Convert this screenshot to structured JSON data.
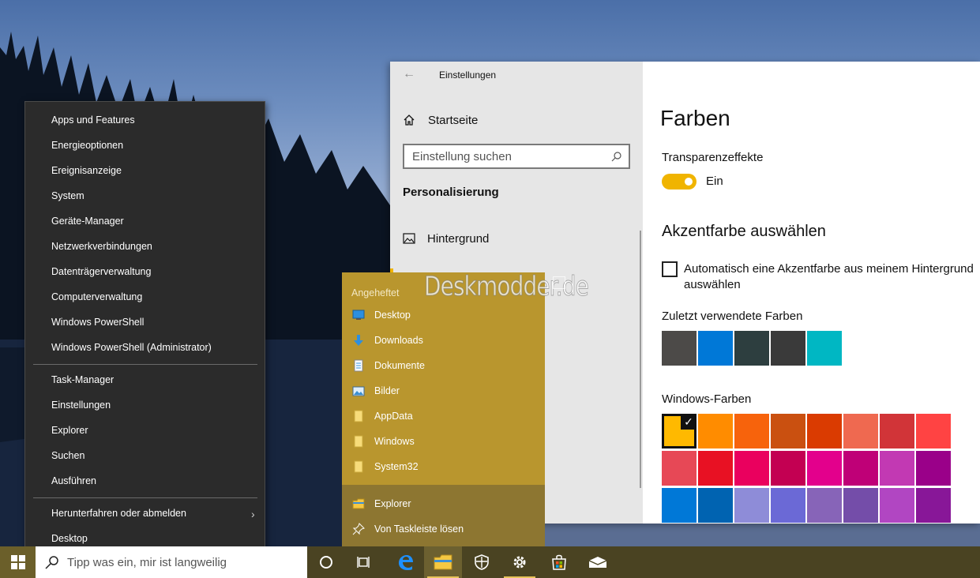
{
  "settings": {
    "app_title": "Einstellungen",
    "home_label": "Startseite",
    "search_placeholder": "Einstellung suchen",
    "section_title": "Personalisierung",
    "nav_items": [
      {
        "label": "Hintergrund",
        "icon": "picture-icon"
      }
    ],
    "content": {
      "page_title": "Farben",
      "transparency_label": "Transparenzeffekte",
      "transparency_state": "Ein",
      "accent_heading": "Akzentfarbe auswählen",
      "auto_accent_label": "Automatisch eine Akzentfarbe aus meinem Hintergrund auswählen",
      "auto_accent_checked": false,
      "recent_heading": "Zuletzt verwendete Farben",
      "recent_colors": [
        "#4c4a48",
        "#0078d7",
        "#2d3e3f",
        "#3a3a3a",
        "#00b7c3"
      ],
      "windows_heading": "Windows-Farben",
      "selected_color": "#ffb900",
      "windows_colors": [
        [
          "#ffb900",
          "#ff8c00",
          "#f7630c",
          "#ca5010",
          "#da3b01",
          "#ef6950",
          "#d13438",
          "#ff4343"
        ],
        [
          "#e74856",
          "#e81123",
          "#ea005e",
          "#c30052",
          "#e3008c",
          "#bf0077",
          "#c239b3",
          "#9a0089"
        ],
        [
          "#0078d7",
          "#0063b1",
          "#8e8cd8",
          "#6b69d6",
          "#8764b8",
          "#744da9",
          "#b146c2",
          "#881798"
        ]
      ],
      "accent_color": "#f0b400"
    }
  },
  "winx_menu": {
    "group1": [
      "Apps und Features",
      "Energieoptionen",
      "Ereignisanzeige",
      "System",
      "Geräte-Manager",
      "Netzwerkverbindungen",
      "Datenträgerverwaltung",
      "Computerverwaltung",
      "Windows PowerShell",
      "Windows PowerShell (Administrator)"
    ],
    "group2": [
      "Task-Manager",
      "Einstellungen",
      "Explorer",
      "Suchen",
      "Ausführen"
    ],
    "group3": [
      "Herunterfahren oder abmelden",
      "Desktop"
    ]
  },
  "jump_list": {
    "header": "Angeheftet",
    "pinned": [
      {
        "label": "Desktop",
        "icon": "desktop-icon"
      },
      {
        "label": "Downloads",
        "icon": "download-icon"
      },
      {
        "label": "Dokumente",
        "icon": "document-icon"
      },
      {
        "label": "Bilder",
        "icon": "picture-icon"
      },
      {
        "label": "AppData",
        "icon": "folder-icon"
      },
      {
        "label": "Windows",
        "icon": "folder-icon"
      },
      {
        "label": "System32",
        "icon": "folder-icon"
      }
    ],
    "actions": [
      {
        "label": "Explorer",
        "icon": "file-explorer-icon"
      },
      {
        "label": "Von Taskleiste lösen",
        "icon": "unpin-icon"
      }
    ]
  },
  "watermark": "Deskmodder.de",
  "taskbar": {
    "search_placeholder": "Tipp was ein, mir ist langweilig",
    "icons": [
      "cortana-icon",
      "task-view-icon",
      "edge-icon",
      "file-explorer-icon",
      "defender-icon",
      "settings-icon",
      "store-icon",
      "mail-icon"
    ],
    "active_icon": "file-explorer-icon"
  }
}
